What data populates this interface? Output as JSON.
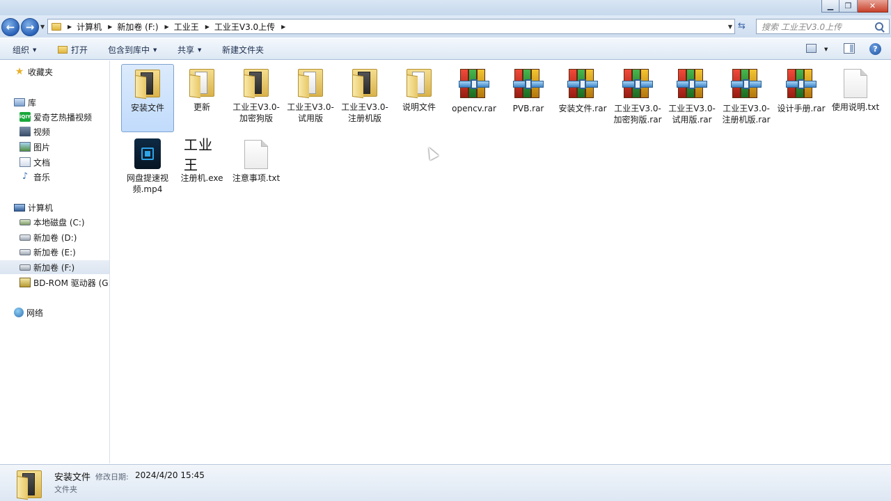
{
  "window": {
    "minimize_glyph": "▁",
    "maximize_glyph": "❐",
    "close_glyph": "✕"
  },
  "address": {
    "breadcrumbs": [
      "计算机",
      "新加卷 (F:)",
      "工业王",
      "工业王V3.0上传"
    ],
    "search_placeholder": "搜索 工业王V3.0上传"
  },
  "toolbar": {
    "organize": "组织",
    "open": "打开",
    "include_in_library": "包含到库中",
    "share": "共享",
    "new_folder": "新建文件夹",
    "help_glyph": "?"
  },
  "navigation": {
    "favorites": "收藏夹",
    "libraries": "库",
    "library_items": [
      "爱奇艺热播视频",
      "视频",
      "图片",
      "文档",
      "音乐"
    ],
    "iqiyi_badge": "iQIYI",
    "computer": "计算机",
    "drives": [
      "本地磁盘 (C:)",
      "新加卷 (D:)",
      "新加卷 (E:)",
      "新加卷 (F:)",
      "BD-ROM 驱动器 (G:)"
    ],
    "network": "网络"
  },
  "files": [
    {
      "name": "安装文件",
      "type": "folder"
    },
    {
      "name": "更新",
      "type": "folder"
    },
    {
      "name": "工业王V3.0-加密狗版",
      "type": "folder"
    },
    {
      "name": "工业王V3.0-试用版",
      "type": "folder"
    },
    {
      "name": "工业王V3.0-注册机版",
      "type": "folder"
    },
    {
      "name": "说明文件",
      "type": "folder"
    },
    {
      "name": "opencv.rar",
      "type": "rar"
    },
    {
      "name": "PVB.rar",
      "type": "rar"
    },
    {
      "name": "安装文件.rar",
      "type": "rar"
    },
    {
      "name": "工业王V3.0-加密狗版.rar",
      "type": "rar"
    },
    {
      "name": "工业王V3.0-试用版.rar",
      "type": "rar"
    },
    {
      "name": "工业王V3.0-注册机版.rar",
      "type": "rar"
    },
    {
      "name": "设计手册.rar",
      "type": "rar"
    },
    {
      "name": "使用说明.txt",
      "type": "txt"
    },
    {
      "name": "网盘提速视频.mp4",
      "type": "mp4"
    },
    {
      "name": "注册机.exe",
      "type": "exe",
      "icon_text": "工业王"
    },
    {
      "name": "注意事项.txt",
      "type": "txt"
    }
  ],
  "details": {
    "name": "安装文件",
    "date_label": "修改日期:",
    "date": "2024/4/20 15:45",
    "type": "文件夹"
  }
}
